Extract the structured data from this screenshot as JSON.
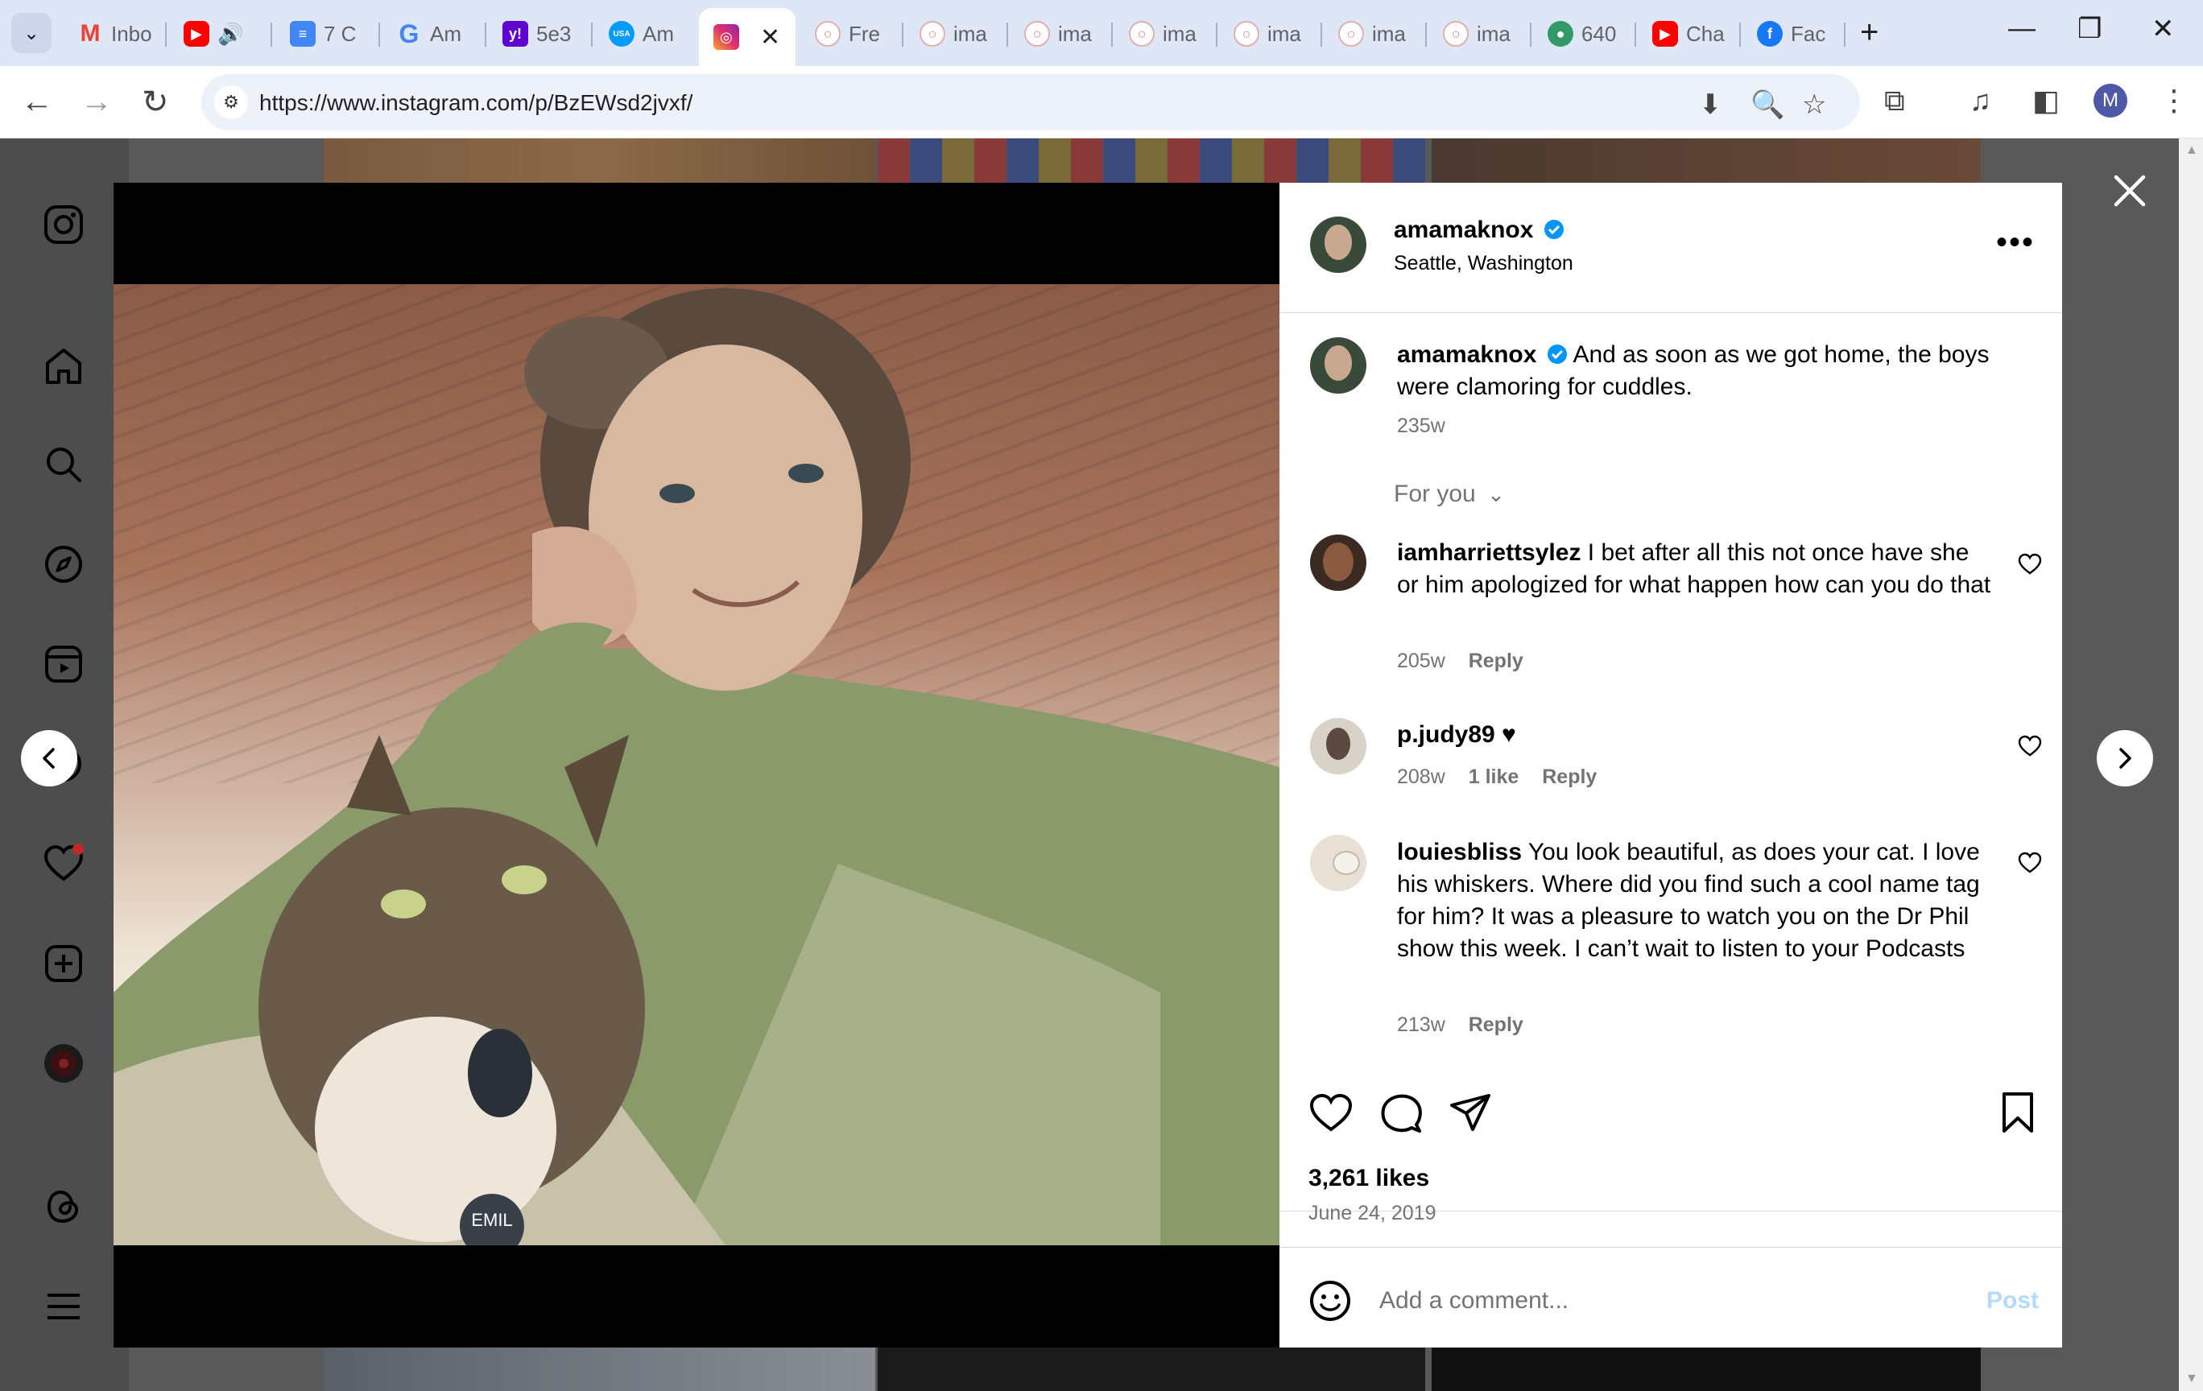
{
  "browser": {
    "tabs": [
      {
        "icon": "gmail-icon",
        "title": "Inbo",
        "color": "#ea4335"
      },
      {
        "icon": "youtube-icon",
        "title": "",
        "color": "#ff0000"
      },
      {
        "icon": "docs-icon",
        "title": "7 C",
        "color": "#4285f4"
      },
      {
        "icon": "google-icon",
        "title": "Am",
        "color": "#4285f4"
      },
      {
        "icon": "yahoo-icon",
        "title": "5e3",
        "color": "#5f01d1"
      },
      {
        "icon": "usatoday-icon",
        "title": "Am",
        "color": "#009bff"
      },
      {
        "icon": "instagram-icon",
        "title": "",
        "color": "#e1306c"
      },
      {
        "icon": "image-icon",
        "title": "Fre",
        "color": "#ffffff"
      },
      {
        "icon": "image-icon",
        "title": "ima",
        "color": "#ffffff"
      },
      {
        "icon": "image-icon",
        "title": "ima",
        "color": "#ffffff"
      },
      {
        "icon": "image-icon",
        "title": "ima",
        "color": "#ffffff"
      },
      {
        "icon": "image-icon",
        "title": "ima",
        "color": "#ffffff"
      },
      {
        "icon": "image-icon",
        "title": "ima",
        "color": "#ffffff"
      },
      {
        "icon": "image-icon",
        "title": "ima",
        "color": "#ffffff"
      },
      {
        "icon": "wikimedia-icon",
        "title": "640",
        "color": "#339966"
      },
      {
        "icon": "youtube-icon",
        "title": "Cha",
        "color": "#ff0000"
      },
      {
        "icon": "facebook-icon",
        "title": "Fac",
        "color": "#1877f2"
      }
    ],
    "url": "https://www.instagram.com/p/BzEWsd2jvxf/"
  },
  "post": {
    "username": "amamaknox",
    "location": "Seattle, Washington",
    "caption": "And as soon as we got home, the boys were clamoring for cuddles.",
    "caption_age": "235w",
    "sort_label": "For you",
    "comments": [
      {
        "user": "iamharriettsylez",
        "text": "I bet after all this not once have she or him apologized for what happen how can you do that",
        "age": "205w",
        "likes": "",
        "reply": "Reply"
      },
      {
        "user": "p.judy89",
        "text": "♥",
        "age": "208w",
        "likes": "1 like",
        "reply": "Reply"
      },
      {
        "user": "louiesbliss",
        "text": "You look beautiful, as does your cat. I love his whiskers. Where did you find such a cool name tag for him? It was a pleasure to watch you on the Dr Phil show this week. I can’t wait to listen to your Podcasts",
        "age": "213w",
        "likes": "",
        "reply": "Reply"
      }
    ],
    "likes_count": "3,261 likes",
    "date": "June 24, 2019",
    "comment_placeholder": "Add a comment...",
    "post_button": "Post",
    "tag_text": "EMIL"
  }
}
